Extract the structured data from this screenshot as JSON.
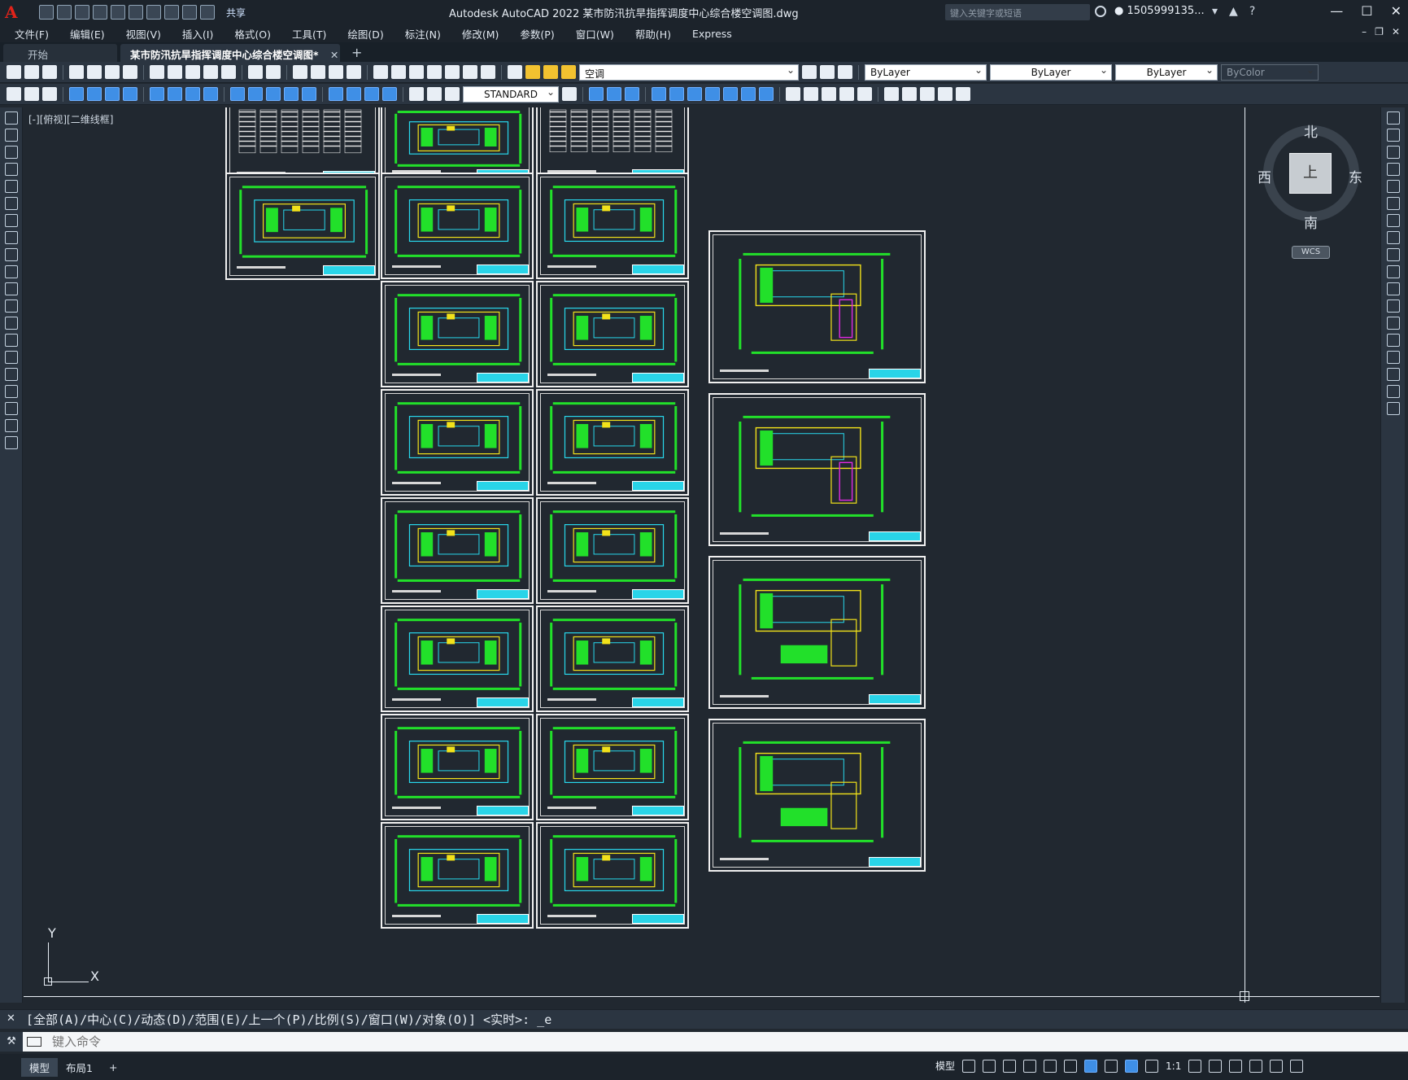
{
  "app": {
    "logo": "A",
    "share_label": "共享",
    "window_title": "Autodesk AutoCAD 2022    某市防汛抗旱指挥调度中心综合楼空调图.dwg",
    "search_placeholder": "键入关键字或短语",
    "user": "1505999135...",
    "window_controls": [
      "—",
      "☐",
      "✕"
    ]
  },
  "menu": [
    "文件(F)",
    "编辑(E)",
    "视图(V)",
    "插入(I)",
    "格式(O)",
    "工具(T)",
    "绘图(D)",
    "标注(N)",
    "修改(M)",
    "参数(P)",
    "窗口(W)",
    "帮助(H)",
    "Express"
  ],
  "tabs": {
    "start": "开始",
    "active": "某市防汛抗旱指挥调度中心综合楼空调图*",
    "close": "✕",
    "add": "+"
  },
  "toolbar": {
    "layer_value": "空调",
    "color_value": "ByLayer",
    "linetype_value": "ByLayer",
    "lineweight_value": "ByLayer",
    "plotstyle_value": "ByColor",
    "textstyle_value": "STANDARD"
  },
  "viewport": {
    "label": "[-][俯视][二维线框]",
    "viewcube_face": "上",
    "compass": {
      "north": "北",
      "south": "南",
      "east": "东",
      "west": "西"
    },
    "wcs": "WCS",
    "ucs_x": "X",
    "ucs_y": "Y"
  },
  "command": {
    "history": "[全部(A)/中心(C)/动态(D)/范围(E)/上一个(P)/比例(S)/窗口(W)/对象(O)] <实时>: _e",
    "input_placeholder": "键入命令"
  },
  "status": {
    "layout_tabs": [
      "模型",
      "布局1"
    ],
    "add_layout": "+",
    "model_label": "模型",
    "scale": "1:1"
  },
  "colors": {
    "background": "#212830",
    "plan_green": "#22e02a",
    "plan_yellow": "#f2e21a",
    "plan_cyan": "#28d8ec",
    "plan_magenta": "#e02ae0",
    "sheet_border": "#f0f0f0"
  }
}
